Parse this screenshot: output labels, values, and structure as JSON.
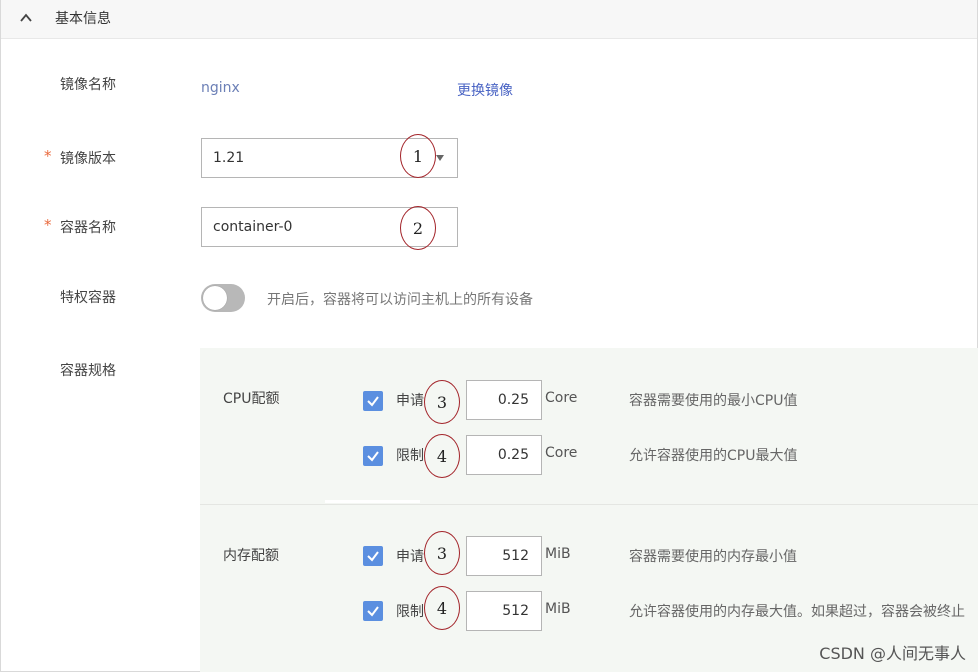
{
  "section": {
    "title": "基本信息",
    "toggle_icon": "chevron-up-icon"
  },
  "image": {
    "label": "镜像名称",
    "value": "nginx",
    "change_link": "更换镜像"
  },
  "image_version": {
    "required_mark": "*",
    "label": "镜像版本",
    "value": "1.21",
    "icon": "caret-down-icon"
  },
  "container_name": {
    "required_mark": "*",
    "label": "容器名称",
    "value": "container-0"
  },
  "privileged": {
    "label": "特权容器",
    "hint": "开启后，容器将可以访问主机上的所有设备",
    "enabled": false
  },
  "spec": {
    "label": "容器规格",
    "cpu": {
      "title": "CPU配额",
      "request": {
        "checked": true,
        "label": "申请",
        "value": "0.25",
        "unit": "Core",
        "desc": "容器需要使用的最小CPU值"
      },
      "limit": {
        "checked": true,
        "label": "限制",
        "value": "0.25",
        "unit": "Core",
        "desc": "允许容器使用的CPU最大值"
      }
    },
    "memory": {
      "title": "内存配额",
      "request": {
        "checked": true,
        "label": "申请",
        "value": "512",
        "unit": "MiB",
        "desc": "容器需要使用的内存最小值"
      },
      "limit": {
        "checked": true,
        "label": "限制",
        "value": "512",
        "unit": "MiB",
        "desc": "允许容器使用的内存最大值。如果超过，容器会被终止"
      }
    }
  },
  "annotations": {
    "a1": "1",
    "a2": "2",
    "a3_cpu": "3",
    "a4_cpu": "4",
    "a3_mem": "3",
    "a4_mem": "4"
  },
  "watermark": "CSDN @人间无事人",
  "colors": {
    "accent": "#5b8fe0",
    "required": "#e96a3e",
    "annotation": "#a3242a",
    "spec_bg": "#f4f7f3"
  }
}
